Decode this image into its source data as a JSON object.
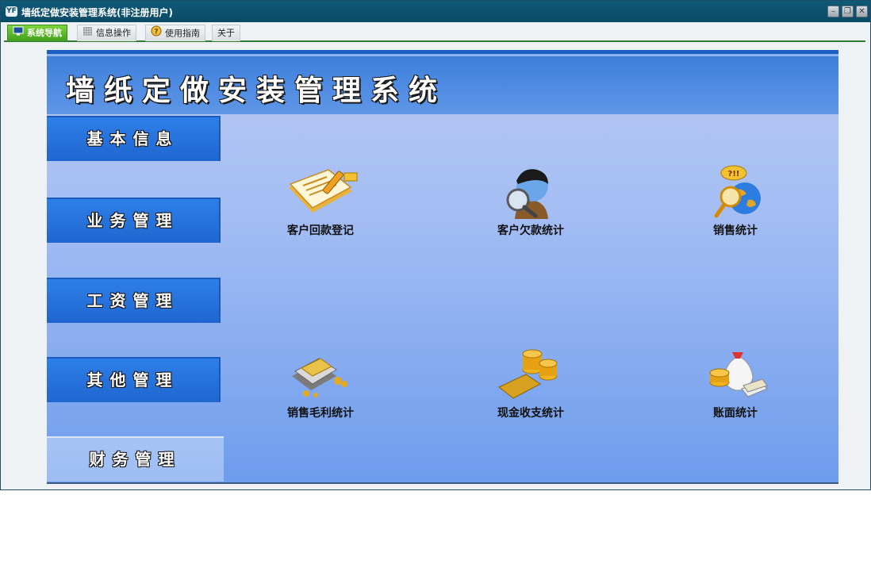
{
  "window": {
    "title": "墙纸定做安装管理系统(非注册用户)",
    "icon_text": "YF",
    "controls": [
      "minimize",
      "restore",
      "close"
    ]
  },
  "menu": {
    "tabs": [
      {
        "label": "系统导航",
        "icon": "monitor-icon",
        "active": true
      },
      {
        "label": "信息操作",
        "icon": "grid-icon",
        "active": false
      },
      {
        "label": "使用指南",
        "icon": "help-icon",
        "active": false
      },
      {
        "label": "关于",
        "icon": "",
        "active": false
      }
    ]
  },
  "banner": {
    "title": "墙纸定做安装管理系统"
  },
  "sidebar": {
    "items": [
      {
        "label": "基本信息",
        "active": false
      },
      {
        "label": "业务管理",
        "active": false
      },
      {
        "label": "工资管理",
        "active": false
      },
      {
        "label": "其他管理",
        "active": false
      },
      {
        "label": "财务管理",
        "active": true
      }
    ]
  },
  "features": [
    {
      "label": "客户回款登记",
      "icon": "notebook-pen-icon"
    },
    {
      "label": "客户欠款统计",
      "icon": "person-magnifier-icon"
    },
    {
      "label": "销售统计",
      "icon": "globe-magnifier-icon"
    },
    {
      "label": "销售毛利统计",
      "icon": "money-stack-icon"
    },
    {
      "label": "现金收支统计",
      "icon": "coins-card-icon"
    },
    {
      "label": "账面统计",
      "icon": "money-bag-icon"
    }
  ],
  "colors": {
    "titlebar": "#0b4f6b",
    "accent_green": "#3f9e1c",
    "panel_blue": "#1f66d0",
    "content_bg": "#a2bcf3"
  }
}
